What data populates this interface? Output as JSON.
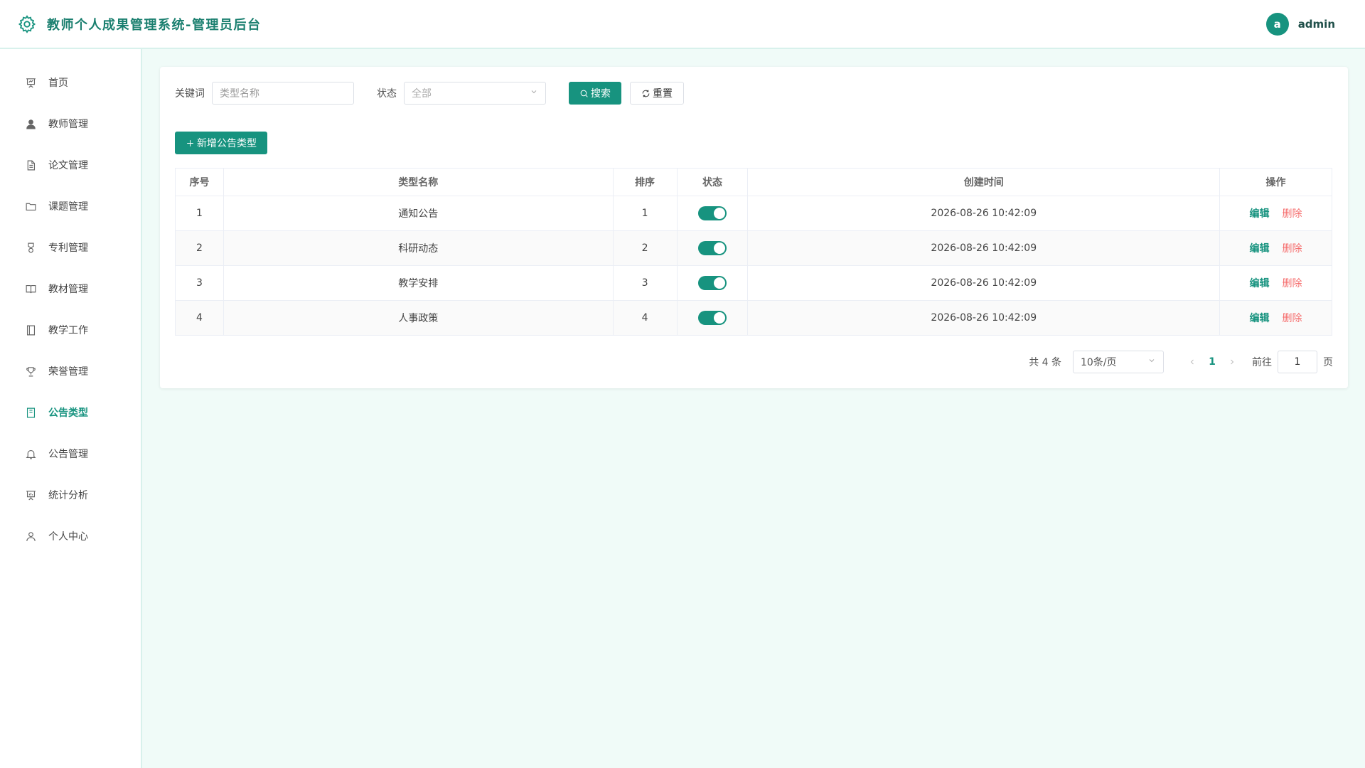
{
  "header": {
    "title": "教师个人成果管理系统-管理员后台",
    "avatar_letter": "a",
    "username": "admin"
  },
  "sidebar": {
    "items": [
      {
        "label": "首页",
        "icon": "presentation-icon",
        "active": false
      },
      {
        "label": "教师管理",
        "icon": "user-filled-icon",
        "active": false
      },
      {
        "label": "论文管理",
        "icon": "document-icon",
        "active": false
      },
      {
        "label": "课题管理",
        "icon": "folder-icon",
        "active": false
      },
      {
        "label": "专利管理",
        "icon": "medal-icon",
        "active": false
      },
      {
        "label": "教材管理",
        "icon": "book-open-icon",
        "active": false
      },
      {
        "label": "教学工作",
        "icon": "notebook-icon",
        "active": false
      },
      {
        "label": "荣誉管理",
        "icon": "trophy-icon",
        "active": false
      },
      {
        "label": "公告类型",
        "icon": "tickets-icon",
        "active": true
      },
      {
        "label": "公告管理",
        "icon": "bell-icon",
        "active": false
      },
      {
        "label": "统计分析",
        "icon": "data-board-icon",
        "active": false
      },
      {
        "label": "个人中心",
        "icon": "user-icon",
        "active": false
      }
    ]
  },
  "filters": {
    "keyword_label": "关键词",
    "keyword_placeholder": "类型名称",
    "status_label": "状态",
    "status_value": "全部",
    "search_label": "搜索",
    "reset_label": "重置"
  },
  "add_button_label": "新增公告类型",
  "table": {
    "headers": [
      "序号",
      "类型名称",
      "排序",
      "状态",
      "创建时间",
      "操作"
    ],
    "rows": [
      {
        "index": "1",
        "name": "通知公告",
        "sort": "1",
        "status": true,
        "created": "2026-08-26 10:42:09"
      },
      {
        "index": "2",
        "name": "科研动态",
        "sort": "2",
        "status": true,
        "created": "2026-08-26 10:42:09"
      },
      {
        "index": "3",
        "name": "教学安排",
        "sort": "3",
        "status": true,
        "created": "2026-08-26 10:42:09"
      },
      {
        "index": "4",
        "name": "人事政策",
        "sort": "4",
        "status": true,
        "created": "2026-08-26 10:42:09"
      }
    ],
    "edit_label": "编辑",
    "delete_label": "删除"
  },
  "pagination": {
    "total_text": "共 4 条",
    "page_size": "10条/页",
    "current_page": "1",
    "goto_label": "前往",
    "goto_value": "1",
    "page_suffix": "页"
  },
  "colors": {
    "primary": "#17937f",
    "danger": "#f56c6c",
    "background": "#f0fbf8"
  }
}
